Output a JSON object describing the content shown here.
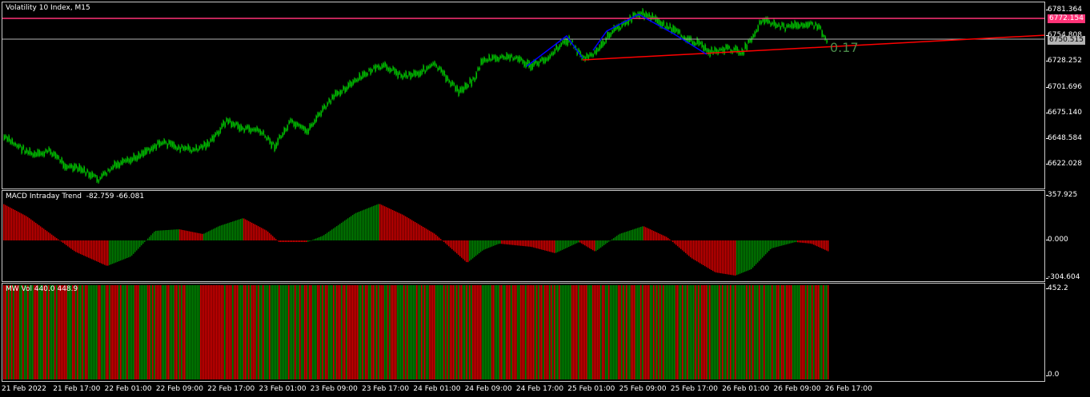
{
  "main_chart": {
    "title": "Volatility 10 Index, M15",
    "price_labels": [
      "6781.364",
      "6754.808",
      "6728.252",
      "6701.696",
      "6675.140",
      "6648.584",
      "6622.028"
    ],
    "badge_resistance": "6772.154",
    "badge_current": "6750.515",
    "pattern_value": "0.17",
    "colors": {
      "candles": "#00c000",
      "resistance": "#ff3377",
      "current": "#b4b4b4",
      "trendline": "#ff0000",
      "pattern": "#0000ff"
    }
  },
  "macd": {
    "title": "MACD Intraday Trend  -82.759 -66.081",
    "labels": [
      "357.925",
      "0.000",
      "-304.604"
    ],
    "colors": {
      "up": "#008000",
      "down": "#cc0000"
    }
  },
  "volume": {
    "title": "MW Vol 440.0 448.9",
    "labels": [
      "452.2",
      "0.0"
    ],
    "colors": {
      "up": "#008000",
      "down": "#cc0000"
    }
  },
  "time_axis": [
    "21 Feb 2022",
    "21 Feb 17:00",
    "22 Feb 01:00",
    "22 Feb 09:00",
    "22 Feb 17:00",
    "23 Feb 01:00",
    "23 Feb 09:00",
    "23 Feb 17:00",
    "24 Feb 01:00",
    "24 Feb 09:00",
    "24 Feb 17:00",
    "25 Feb 01:00",
    "25 Feb 09:00",
    "25 Feb 17:00",
    "26 Feb 01:00",
    "26 Feb 09:00",
    "26 Feb 17:00"
  ]
}
